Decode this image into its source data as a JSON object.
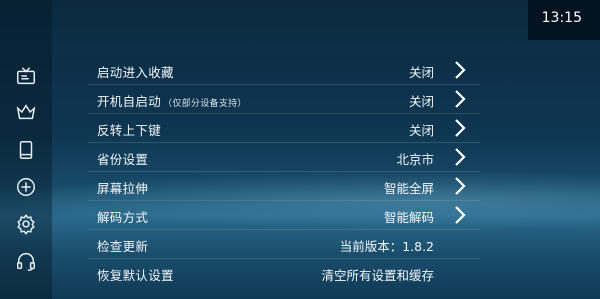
{
  "clock": {
    "time": "13:15"
  },
  "sidebar": {
    "items": [
      {
        "icon": "tv-icon"
      },
      {
        "icon": "crown-icon"
      },
      {
        "icon": "tablet-icon"
      },
      {
        "icon": "add-circle-icon"
      },
      {
        "icon": "gear-icon",
        "active": true
      },
      {
        "icon": "headset-icon"
      }
    ]
  },
  "settings": {
    "rows": [
      {
        "label": "启动进入收藏",
        "sub": "",
        "value": "关闭",
        "has_arrow": true
      },
      {
        "label": "开机自启动",
        "sub": "（仅部分设备支持）",
        "value": "关闭",
        "has_arrow": true
      },
      {
        "label": "反转上下键",
        "sub": "",
        "value": "关闭",
        "has_arrow": true
      },
      {
        "label": "省份设置",
        "sub": "",
        "value": "北京市",
        "has_arrow": true
      },
      {
        "label": "屏幕拉伸",
        "sub": "",
        "value": "智能全屏",
        "has_arrow": true
      },
      {
        "label": "解码方式",
        "sub": "",
        "value": "智能解码",
        "has_arrow": true
      },
      {
        "label": "检查更新",
        "sub": "",
        "value": "当前版本：1.8.2",
        "has_arrow": false
      },
      {
        "label": "恢复默认设置",
        "sub": "",
        "value": "清空所有设置和缓存",
        "has_arrow": false
      }
    ]
  }
}
